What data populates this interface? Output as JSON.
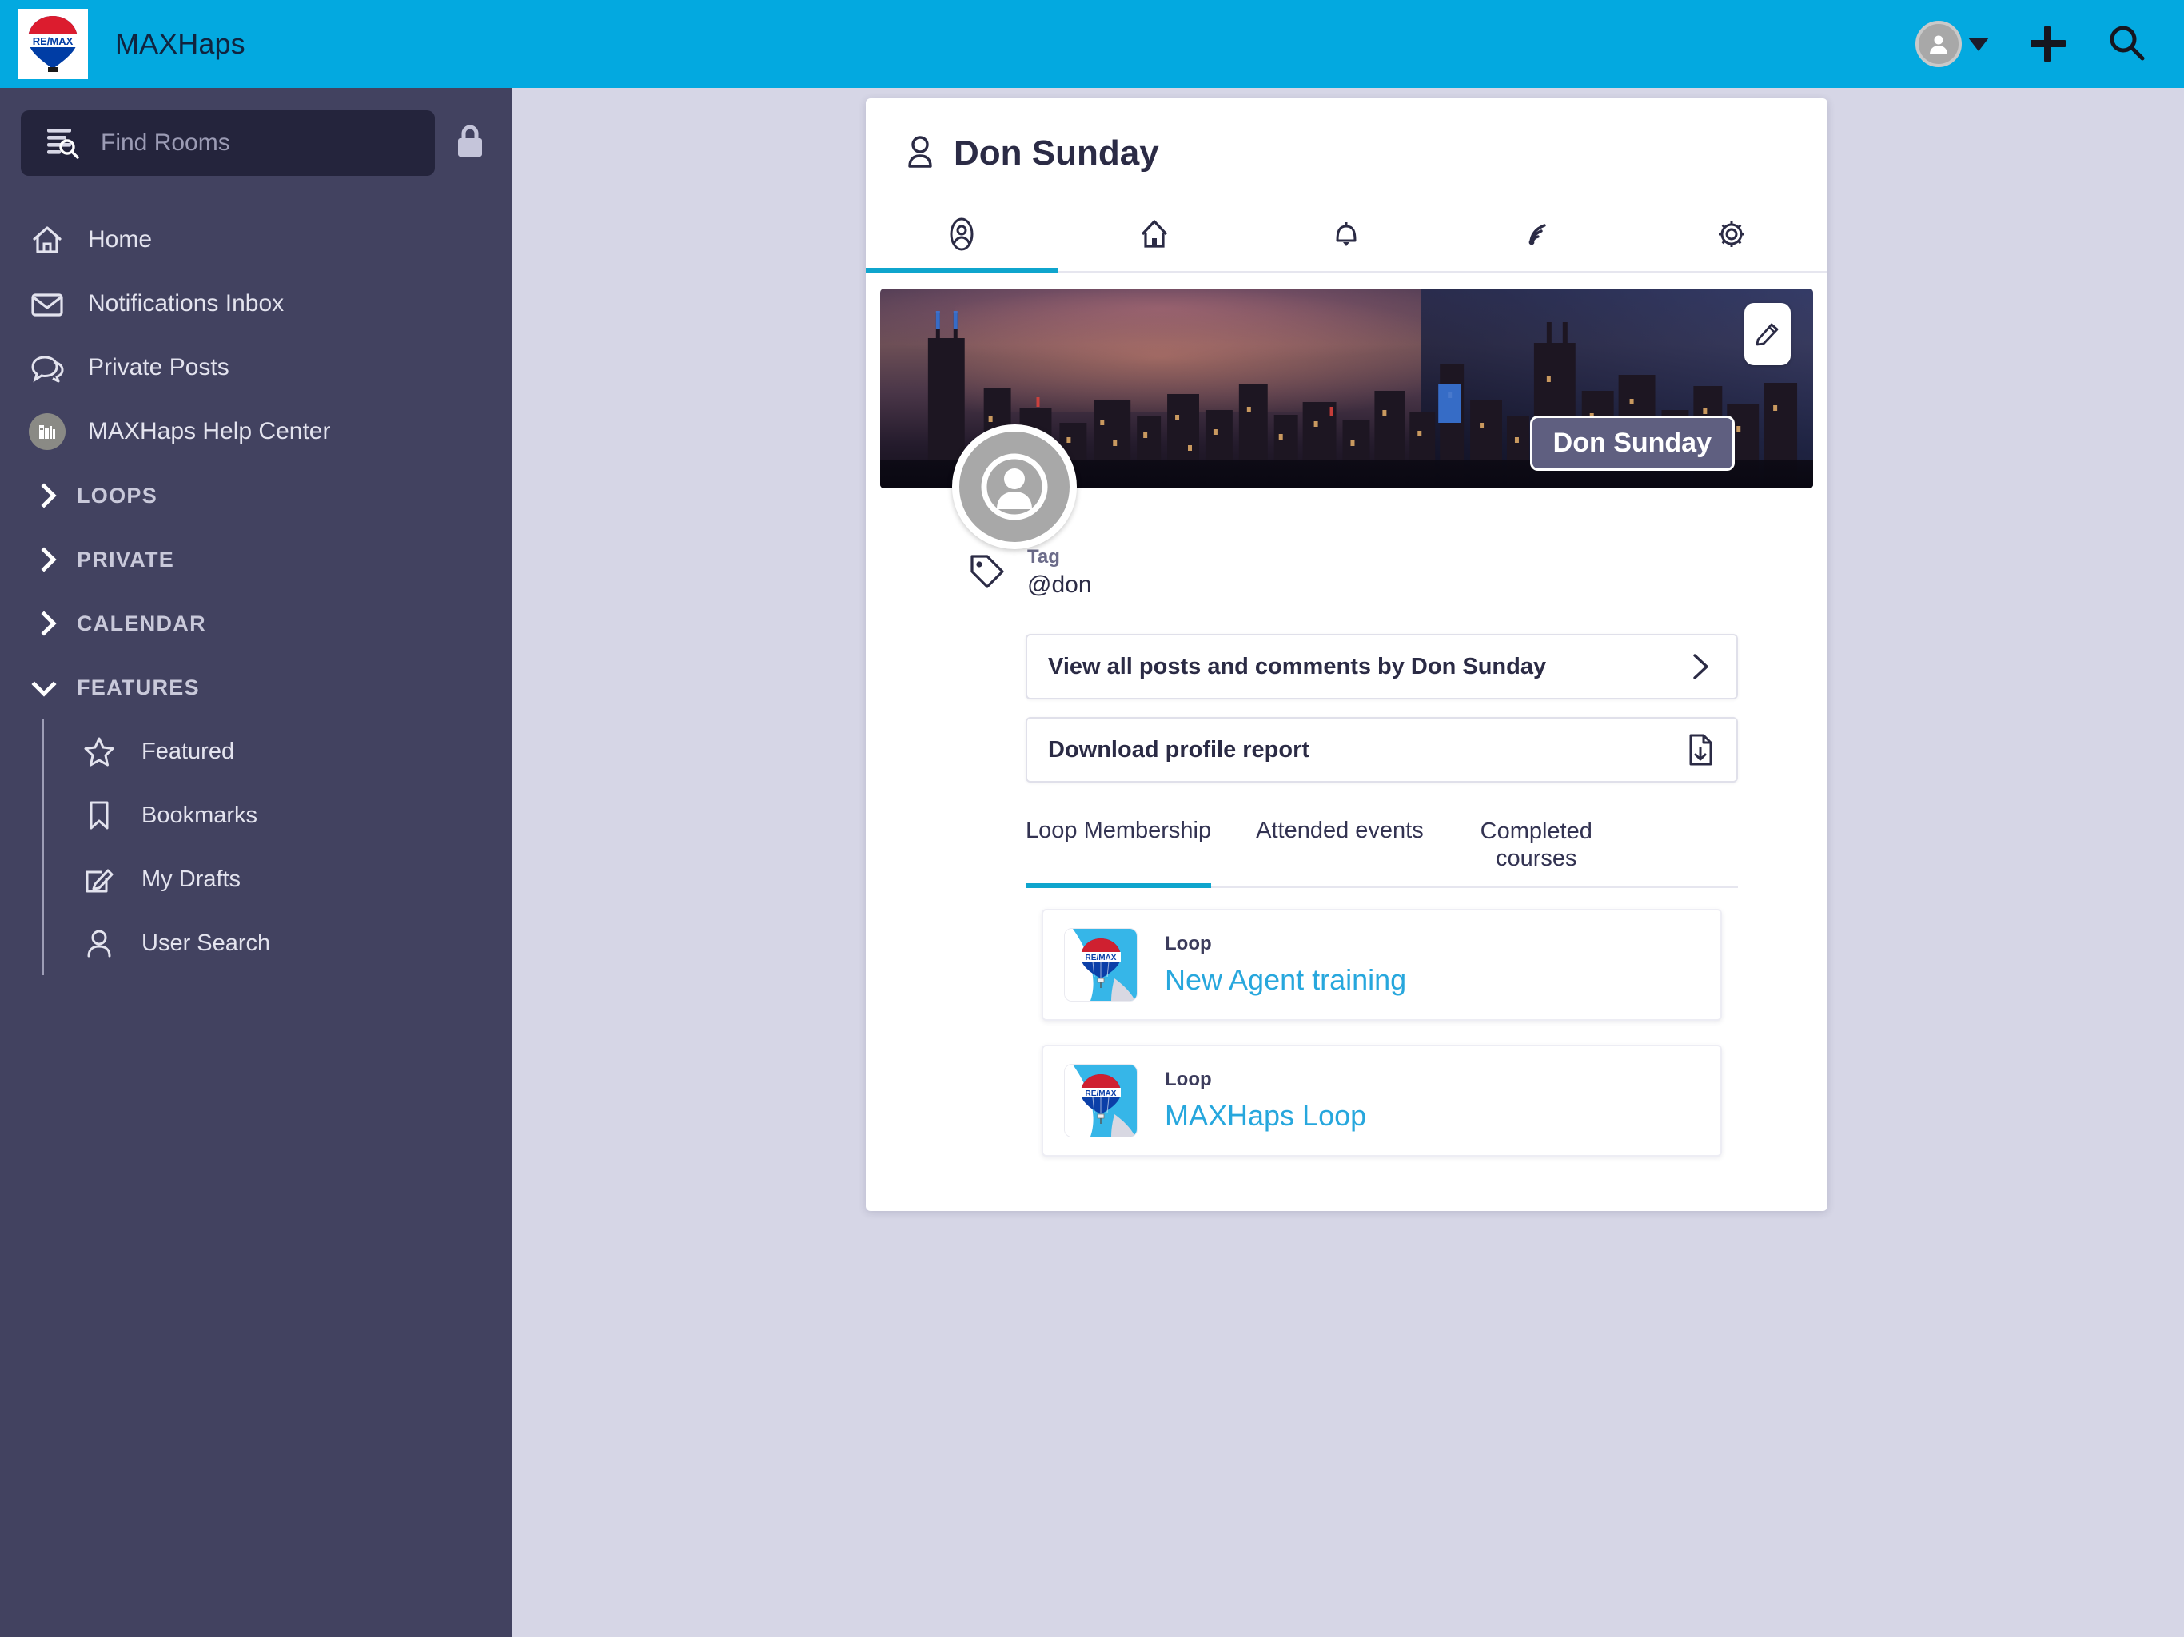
{
  "topbar": {
    "brand_title": "MAXHaps",
    "logo_icon": "remax-balloon-logo",
    "avatar_icon": "user-avatar-icon",
    "caret_icon": "caret-down-icon",
    "plus_icon": "plus-icon",
    "search_icon": "search-icon"
  },
  "sidebar": {
    "search": {
      "placeholder": "Find Rooms",
      "icon": "list-search-icon",
      "lock_icon": "lock-icon"
    },
    "items": [
      {
        "label": "Home",
        "icon": "home-icon"
      },
      {
        "label": "Notifications Inbox",
        "icon": "envelope-icon"
      },
      {
        "label": "Private Posts",
        "icon": "chat-bubbles-icon"
      },
      {
        "label": "MAXHaps Help Center",
        "icon": "books-library-icon"
      }
    ],
    "groups": [
      {
        "label": "LOOPS",
        "expanded": false,
        "icon": "chevron-right-icon"
      },
      {
        "label": "PRIVATE",
        "expanded": false,
        "icon": "chevron-right-icon"
      },
      {
        "label": "CALENDAR",
        "expanded": false,
        "icon": "chevron-right-icon"
      },
      {
        "label": "FEATURES",
        "expanded": true,
        "icon": "chevron-down-icon"
      }
    ],
    "features_items": [
      {
        "label": "Featured",
        "icon": "star-icon"
      },
      {
        "label": "Bookmarks",
        "icon": "bookmark-icon"
      },
      {
        "label": "My Drafts",
        "icon": "edit-square-icon"
      },
      {
        "label": "User Search",
        "icon": "person-icon"
      }
    ]
  },
  "profile": {
    "title": "Don Sunday",
    "title_icon": "person-icon",
    "tabs": [
      {
        "icon": "profile-circle-icon",
        "active": true
      },
      {
        "icon": "home-icon",
        "active": false
      },
      {
        "icon": "bell-icon",
        "active": false
      },
      {
        "icon": "rss-feed-icon",
        "active": false
      },
      {
        "icon": "gear-icon",
        "active": false
      }
    ],
    "cover": {
      "edit_icon": "pencil-edit-icon",
      "name_badge": "Don Sunday",
      "avatar_icon": "user-avatar-placeholder-icon"
    },
    "tag": {
      "icon": "tag-icon",
      "label": "Tag",
      "value": "@don"
    },
    "actions": [
      {
        "label": "View all posts and comments by Don Sunday",
        "icon": "chevron-right-icon"
      },
      {
        "label": "Download profile report",
        "icon": "file-download-icon"
      }
    ],
    "subtabs": [
      {
        "label": "Loop Membership",
        "active": true
      },
      {
        "label": "Attended events",
        "active": false
      },
      {
        "label": "Completed courses",
        "active": false
      }
    ],
    "loops": [
      {
        "kind": "Loop",
        "name": "New Agent training",
        "thumb_icon": "remax-balloon-thumb"
      },
      {
        "kind": "Loop",
        "name": "MAXHaps Loop",
        "thumb_icon": "remax-balloon-thumb"
      }
    ]
  },
  "colors": {
    "accent_cyan": "#03a9e0",
    "tab_underline": "#0fa5cd",
    "sidebar_bg": "#424260",
    "page_bg": "#d6d6e6",
    "link_blue": "#27a7dd",
    "remax_red": "#dc1c2e",
    "remax_blue": "#003da5"
  }
}
